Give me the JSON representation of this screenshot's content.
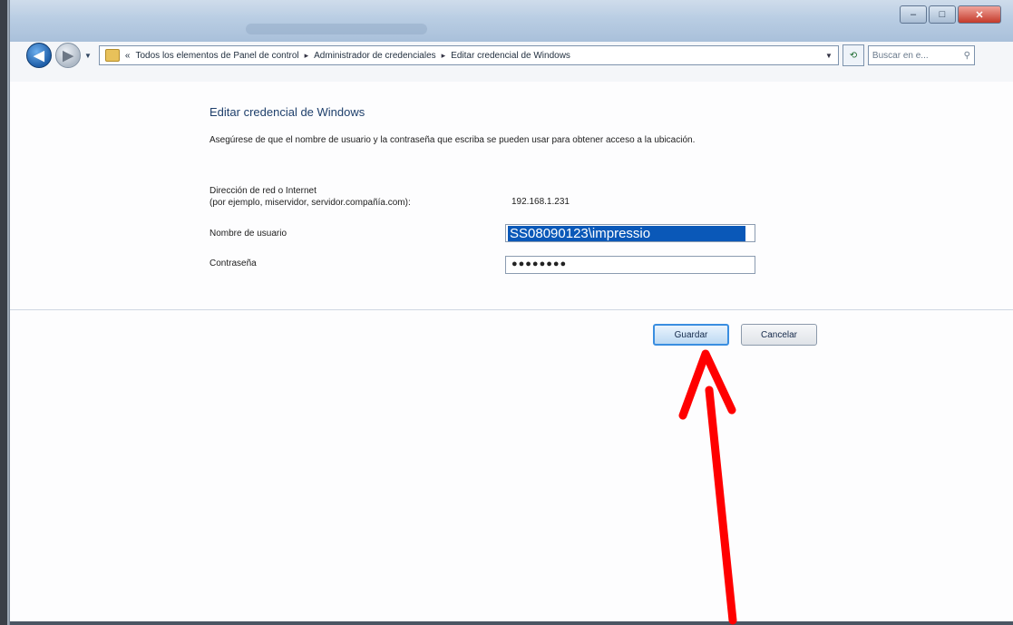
{
  "breadcrumb": {
    "back_symbol": "«",
    "items": [
      "Todos los elementos de Panel de control",
      "Administrador de credenciales",
      "Editar credencial de Windows"
    ],
    "separator": "▸"
  },
  "search": {
    "placeholder": "Buscar en e..."
  },
  "form": {
    "heading": "Editar credencial de Windows",
    "description": "Asegúrese de que el nombre de usuario y la contraseña que escriba se pueden usar para obtener acceso a la ubicación.",
    "address_label_line1": "Dirección de red o Internet",
    "address_label_line2": "(por ejemplo, miservidor, servidor.compañía.com):",
    "address_value": "192.168.1.231",
    "username_label": "Nombre de usuario",
    "username_value": "SS08090123\\impressio",
    "password_label": "Contraseña",
    "password_value": "●●●●●●●●"
  },
  "buttons": {
    "save_label": "Guardar",
    "cancel_label": "Cancelar"
  },
  "colors": {
    "annotation_arrow": "#ff0000",
    "selection": "#0a58b8",
    "heading": "#1e3f6b"
  }
}
